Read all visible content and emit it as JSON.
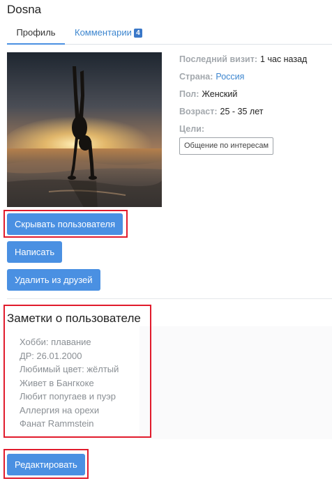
{
  "header": {
    "username": "Dosna"
  },
  "tabs": [
    {
      "label": "Профиль"
    },
    {
      "label": "Комментарии",
      "badge": "4"
    }
  ],
  "profile": {
    "last_visit": {
      "label": "Последний визит:",
      "value": "1 час назад"
    },
    "country": {
      "label": "Страна:",
      "value": "Россия"
    },
    "gender": {
      "label": "Пол:",
      "value": "Женский"
    },
    "age": {
      "label": "Возраст:",
      "value": "25 - 35 лет"
    },
    "goals": {
      "label": "Цели:",
      "tag": "Общение по интересам"
    }
  },
  "buttons": {
    "hide_user": "Скрывать пользователя",
    "write": "Написать",
    "remove_friend": "Удалить из друзей",
    "edit": "Редактировать"
  },
  "notes": {
    "title": "Заметки о пользователе",
    "items": [
      "Хобби: плавание",
      "ДР: 26.01.2000",
      "Любимый цвет: жёлтый",
      "Живет в Бангкоке",
      "Любит попугаев и пуэр",
      "Аллергия на орехи",
      "Фанат Rammstein"
    ]
  },
  "colors": {
    "accent": "#4a90e2",
    "link": "#3d86cf",
    "badge": "#3a78c8",
    "highlight_border": "#e11b2c"
  }
}
